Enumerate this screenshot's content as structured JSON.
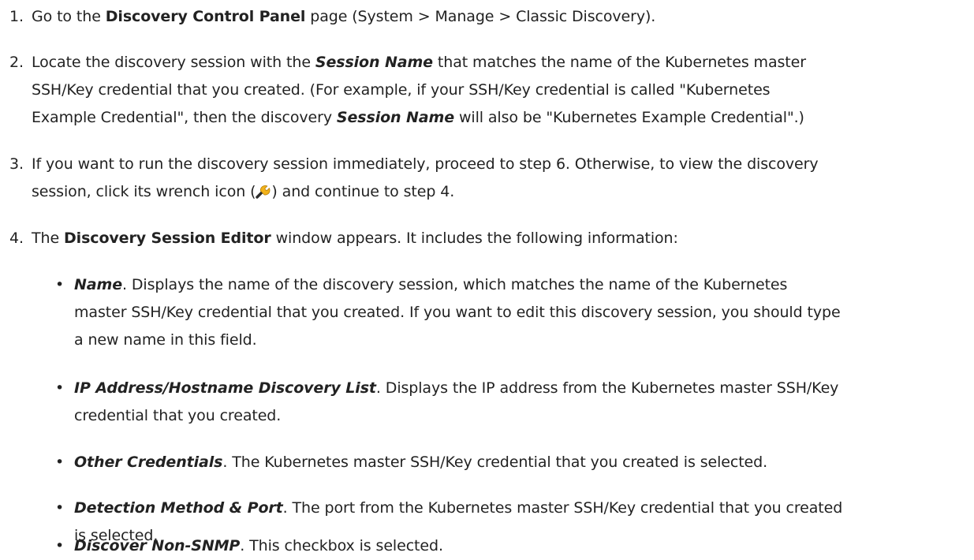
{
  "steps": [
    {
      "num": "1.",
      "parts": [
        "Go to the ",
        "Discovery Control Panel",
        " page (System > Manage > Classic Discovery)."
      ]
    },
    {
      "num": "2.",
      "line1": [
        "Locate the discovery session with the ",
        "Session Name",
        " that matches the name of the Kubernetes master"
      ],
      "line2": "SSH/Key credential that you created. (For example, if your SSH/Key credential is called \"Kubernetes",
      "line3": [
        "Example Credential\", then the discovery ",
        "Session Name",
        " will also be \"Kubernetes Example Credential\".)"
      ]
    },
    {
      "num": "3.",
      "line1": "If you want to run the discovery session immediately, proceed to step 6. Otherwise, to view the discovery",
      "line2a": "session, click its wrench icon (",
      "line2b": ") and continue to step 4."
    },
    {
      "num": "4.",
      "parts": [
        "The ",
        "Discovery Session Editor",
        " window appears. It includes the following information:"
      ]
    }
  ],
  "bullets": [
    {
      "field": "Name",
      "line1": ". Displays the name of the discovery session, which matches the name of the Kubernetes",
      "line2": "master SSH/Key credential that you created. If you want to edit this discovery session, you should type",
      "line3": "a new name in this field."
    },
    {
      "field": "IP Address/Hostname Discovery List",
      "line1": ". Displays the IP address from the Kubernetes master SSH/Key",
      "line2": "credential that you created."
    },
    {
      "field": "Other Credentials",
      "line1": ". The Kubernetes master SSH/Key credential that you created is selected."
    },
    {
      "field": "Detection Method & Port",
      "line1": ". The port from the Kubernetes master SSH/Key credential that you created",
      "line2": "is selected."
    },
    {
      "field": "Discover Non-SNMP",
      "line1": ". This checkbox is selected."
    }
  ],
  "bullet_glyph": "•",
  "icons": {
    "wrench": "wrench-icon",
    "wrench_color": "#f2b21a",
    "wrench_handle_color": "#2d2d2d"
  }
}
